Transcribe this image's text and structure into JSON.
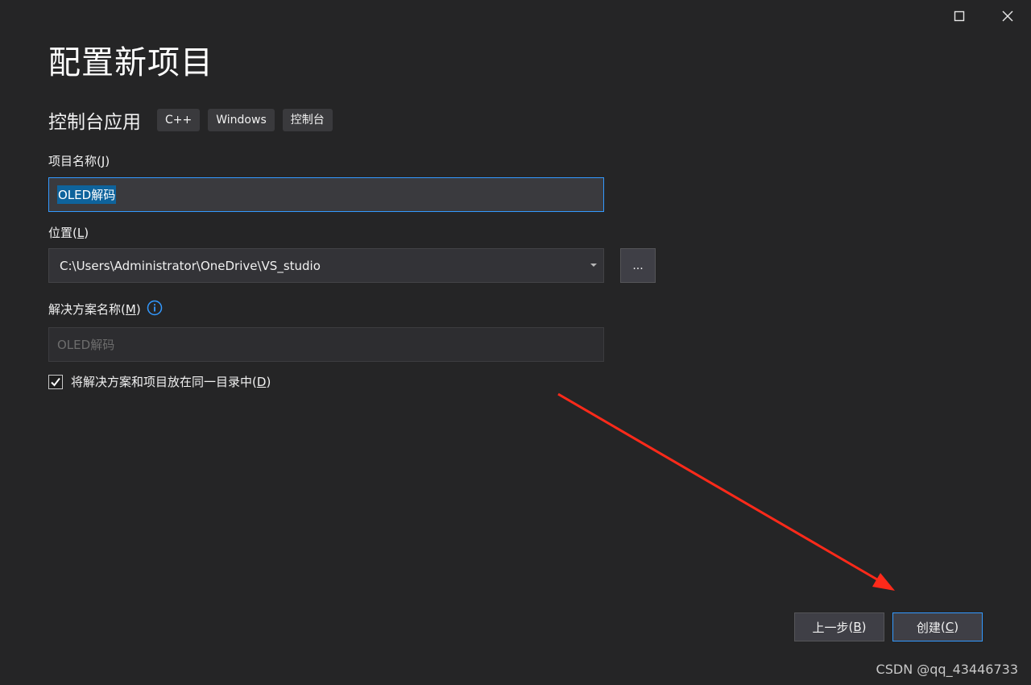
{
  "window": {
    "title": "配置新项目",
    "icons": {
      "maximize": "maximize-icon",
      "close": "close-icon"
    }
  },
  "template": {
    "name": "控制台应用",
    "tags": [
      "C++",
      "Windows",
      "控制台"
    ]
  },
  "project_name": {
    "label": "项目名称",
    "mnemonic": "J",
    "value": "OLED解码"
  },
  "location": {
    "label": "位置",
    "mnemonic": "L",
    "value": "C:\\Users\\Administrator\\OneDrive\\VS_studio",
    "browse_label": "..."
  },
  "solution_name": {
    "label": "解决方案名称",
    "mnemonic": "M",
    "placeholder": "OLED解码",
    "info_icon": "info-icon"
  },
  "same_directory": {
    "label": "将解决方案和项目放在同一目录中",
    "mnemonic": "D",
    "checked": true
  },
  "buttons": {
    "back": {
      "label": "上一步",
      "mnemonic": "B"
    },
    "create": {
      "label": "创建",
      "mnemonic": "C"
    }
  },
  "annotation": {
    "type": "red-arrow",
    "color": "#ff2a1a"
  },
  "watermark": "CSDN @qq_43446733",
  "colors": {
    "background": "#252526",
    "accent": "#3399ff",
    "selection": "#0e639c"
  }
}
